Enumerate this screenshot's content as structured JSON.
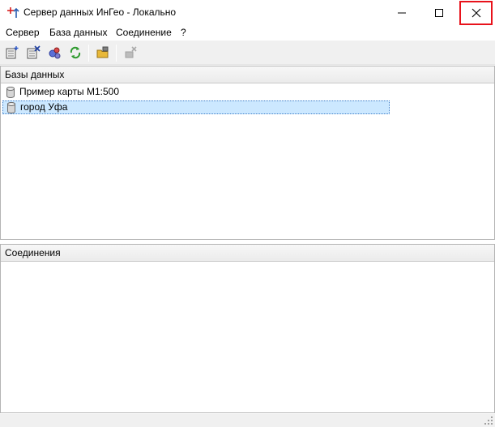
{
  "window": {
    "title": "Сервер данных ИнГео - Локально",
    "close_highlight_color": "#e8121b"
  },
  "menu": [
    {
      "label": "Сервер"
    },
    {
      "label": "База данных"
    },
    {
      "label": "Соединение"
    },
    {
      "label": "?"
    }
  ],
  "toolbar": {
    "buttons": [
      {
        "icon": "add-database-icon"
      },
      {
        "icon": "remove-database-icon"
      },
      {
        "icon": "database-properties-icon"
      },
      {
        "icon": "refresh-icon"
      },
      {
        "icon": "open-folder-icon"
      },
      {
        "icon": "disconnect-icon",
        "enabled": false
      }
    ]
  },
  "databases_panel": {
    "header": "Базы данных",
    "items": [
      {
        "label": "Пример карты М1:500",
        "icon": "database-icon",
        "selected": false
      },
      {
        "label": "город Уфа",
        "icon": "database-icon",
        "selected": true
      }
    ],
    "selection_color": "#cce8ff"
  },
  "connections_panel": {
    "header": "Соединения",
    "items": []
  }
}
